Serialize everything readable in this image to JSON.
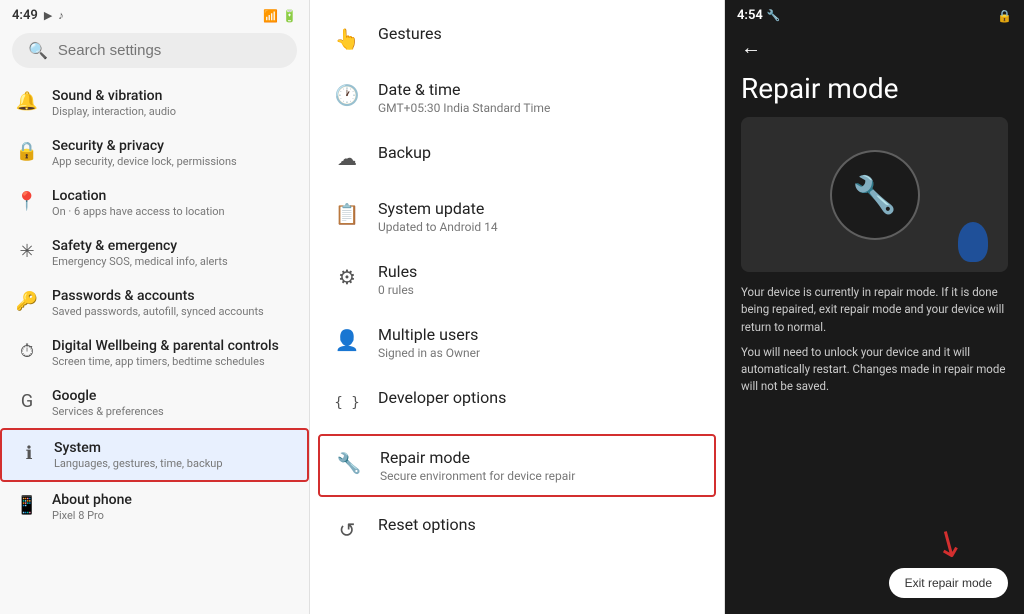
{
  "left": {
    "status_time": "4:49",
    "search_placeholder": "Search settings",
    "items": [
      {
        "id": "sound",
        "icon": "🔔",
        "title": "Sound & vibration",
        "subtitle": "Display, interaction, audio"
      },
      {
        "id": "security",
        "icon": "🔒",
        "title": "Security & privacy",
        "subtitle": "App security, device lock, permissions"
      },
      {
        "id": "location",
        "icon": "📍",
        "title": "Location",
        "subtitle": "On · 6 apps have access to location"
      },
      {
        "id": "safety",
        "icon": "✳",
        "title": "Safety & emergency",
        "subtitle": "Emergency SOS, medical info, alerts"
      },
      {
        "id": "passwords",
        "icon": "🔑",
        "title": "Passwords & accounts",
        "subtitle": "Saved passwords, autofill, synced accounts"
      },
      {
        "id": "wellbeing",
        "icon": "⏱",
        "title": "Digital Wellbeing & parental controls",
        "subtitle": "Screen time, app timers, bedtime schedules"
      },
      {
        "id": "google",
        "icon": "G",
        "title": "Google",
        "subtitle": "Services & preferences"
      },
      {
        "id": "system",
        "icon": "ℹ",
        "title": "System",
        "subtitle": "Languages, gestures, time, backup",
        "active": true
      },
      {
        "id": "about",
        "icon": "📱",
        "title": "About phone",
        "subtitle": "Pixel 8 Pro"
      }
    ]
  },
  "middle": {
    "items": [
      {
        "id": "gestures",
        "icon": "👆",
        "title": "Gestures",
        "subtitle": ""
      },
      {
        "id": "datetime",
        "icon": "🕐",
        "title": "Date & time",
        "subtitle": "GMT+05:30 India Standard Time"
      },
      {
        "id": "backup",
        "icon": "☁",
        "title": "Backup",
        "subtitle": ""
      },
      {
        "id": "sysupdate",
        "icon": "📋",
        "title": "System update",
        "subtitle": "Updated to Android 14"
      },
      {
        "id": "rules",
        "icon": "⚙",
        "title": "Rules",
        "subtitle": "0 rules"
      },
      {
        "id": "multiusers",
        "icon": "👤",
        "title": "Multiple users",
        "subtitle": "Signed in as Owner"
      },
      {
        "id": "developer",
        "icon": "{}",
        "title": "Developer options",
        "subtitle": ""
      },
      {
        "id": "repairmode",
        "icon": "🔧",
        "title": "Repair mode",
        "subtitle": "Secure environment for device repair",
        "highlighted": true
      },
      {
        "id": "reset",
        "icon": "↺",
        "title": "Reset options",
        "subtitle": ""
      }
    ]
  },
  "right": {
    "status_time": "4:54",
    "title": "Repair mode",
    "description1": "Your device is currently in repair mode. If it is done being repaired, exit repair mode and your device will return to normal.",
    "description2": "You will need to unlock your device and it will automatically restart. Changes made in repair mode will not be saved.",
    "exit_button_label": "Exit repair mode",
    "back_icon": "←"
  }
}
